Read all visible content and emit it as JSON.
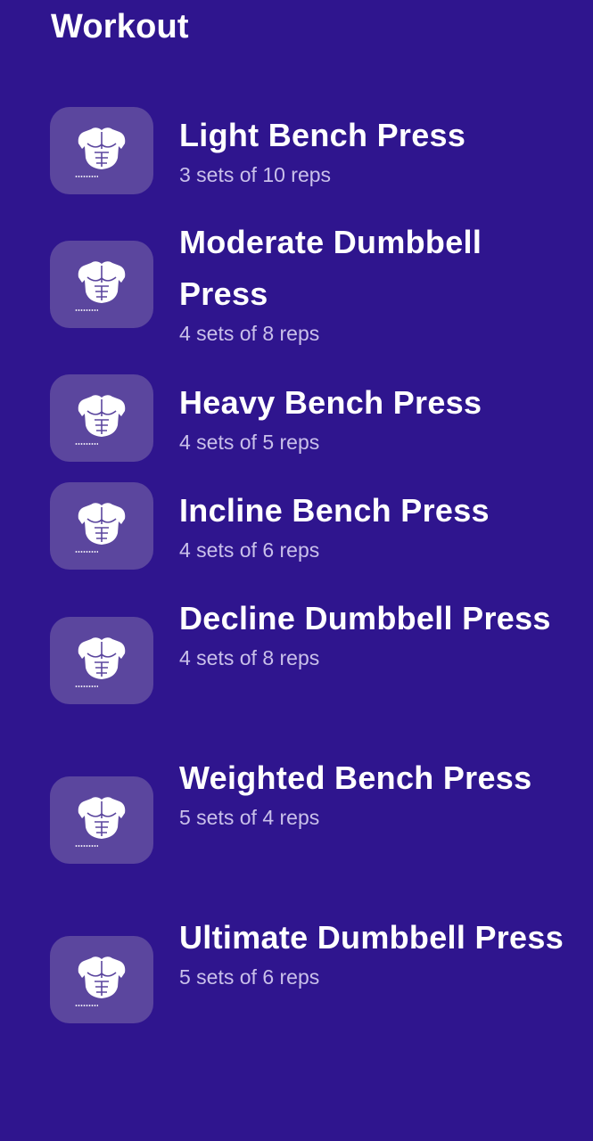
{
  "header": {
    "title": "Workout"
  },
  "exercises": [
    {
      "name": "Light Bench Press",
      "detail": "3 sets of 10 reps",
      "icon": "chest-muscle-icon"
    },
    {
      "name": "Moderate Dumbbell Press",
      "detail": "4 sets of 8 reps",
      "icon": "chest-muscle-icon"
    },
    {
      "name": "Heavy Bench Press",
      "detail": "4 sets of 5 reps",
      "icon": "chest-muscle-icon"
    },
    {
      "name": "Incline Bench Press",
      "detail": "4 sets of 6 reps",
      "icon": "chest-muscle-icon"
    },
    {
      "name": "Decline Dumbbell Press",
      "detail": "4 sets of 8 reps",
      "icon": "chest-muscle-icon"
    },
    {
      "name": "Weighted Bench Press",
      "detail": "5 sets of 4 reps",
      "icon": "chest-muscle-icon"
    },
    {
      "name": "Ultimate Dumbbell Press",
      "detail": "5 sets of 6 reps",
      "icon": "chest-muscle-icon"
    }
  ],
  "colors": {
    "background": "#2f158e",
    "thumbnail": "#5b469e",
    "primary_text": "#ffffff",
    "secondary_text": "#c9c0ea"
  }
}
